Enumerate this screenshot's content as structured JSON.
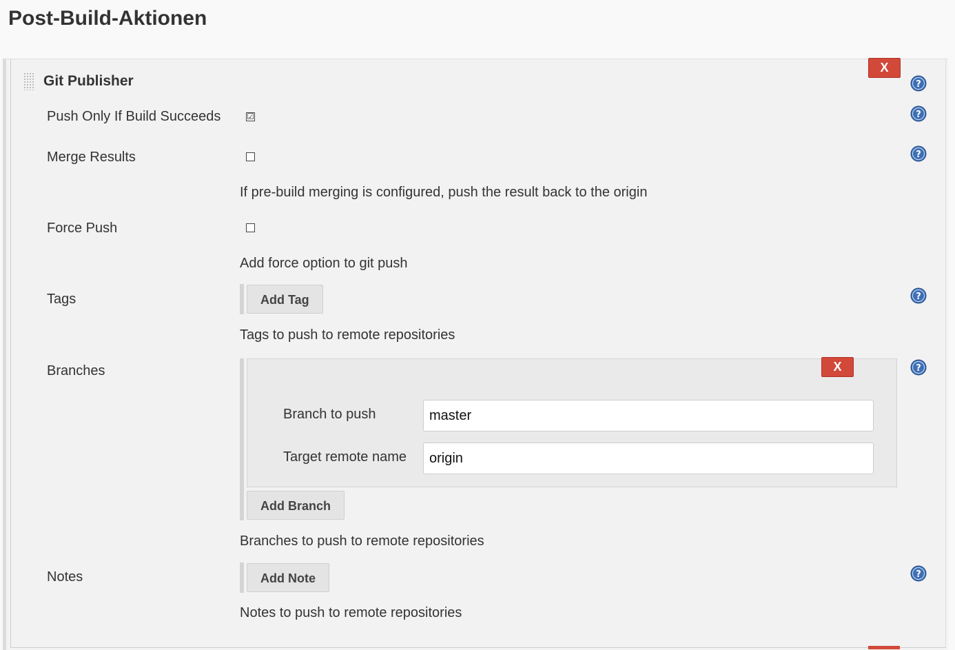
{
  "page_title": "Post-Build-Aktionen",
  "publisher": {
    "name": "Git Publisher",
    "delete_label": "X"
  },
  "fields": {
    "push_only": {
      "label": "Push Only If Build Succeeds",
      "checked": true
    },
    "merge_results": {
      "label": "Merge Results",
      "checked": false,
      "description": "If pre-build merging is configured, push the result back to the origin"
    },
    "force_push": {
      "label": "Force Push",
      "checked": false,
      "description": "Add force option to git push"
    },
    "tags": {
      "label": "Tags",
      "button": "Add Tag",
      "description": "Tags to push to remote repositories"
    },
    "branches": {
      "label": "Branches",
      "delete_label": "X",
      "branch_to_push_label": "Branch to push",
      "branch_to_push_value": "master",
      "target_remote_label": "Target remote name",
      "target_remote_value": "origin",
      "button": "Add Branch",
      "description": "Branches to push to remote repositories"
    },
    "notes": {
      "label": "Notes",
      "button": "Add Note",
      "description": "Notes to push to remote repositories"
    }
  },
  "colors": {
    "delete_red": "#d24939",
    "help_blue": "#3d6fb6"
  },
  "icons": {
    "help": "help-icon",
    "grip": "drag-handle-icon",
    "checkmark": "☑"
  }
}
